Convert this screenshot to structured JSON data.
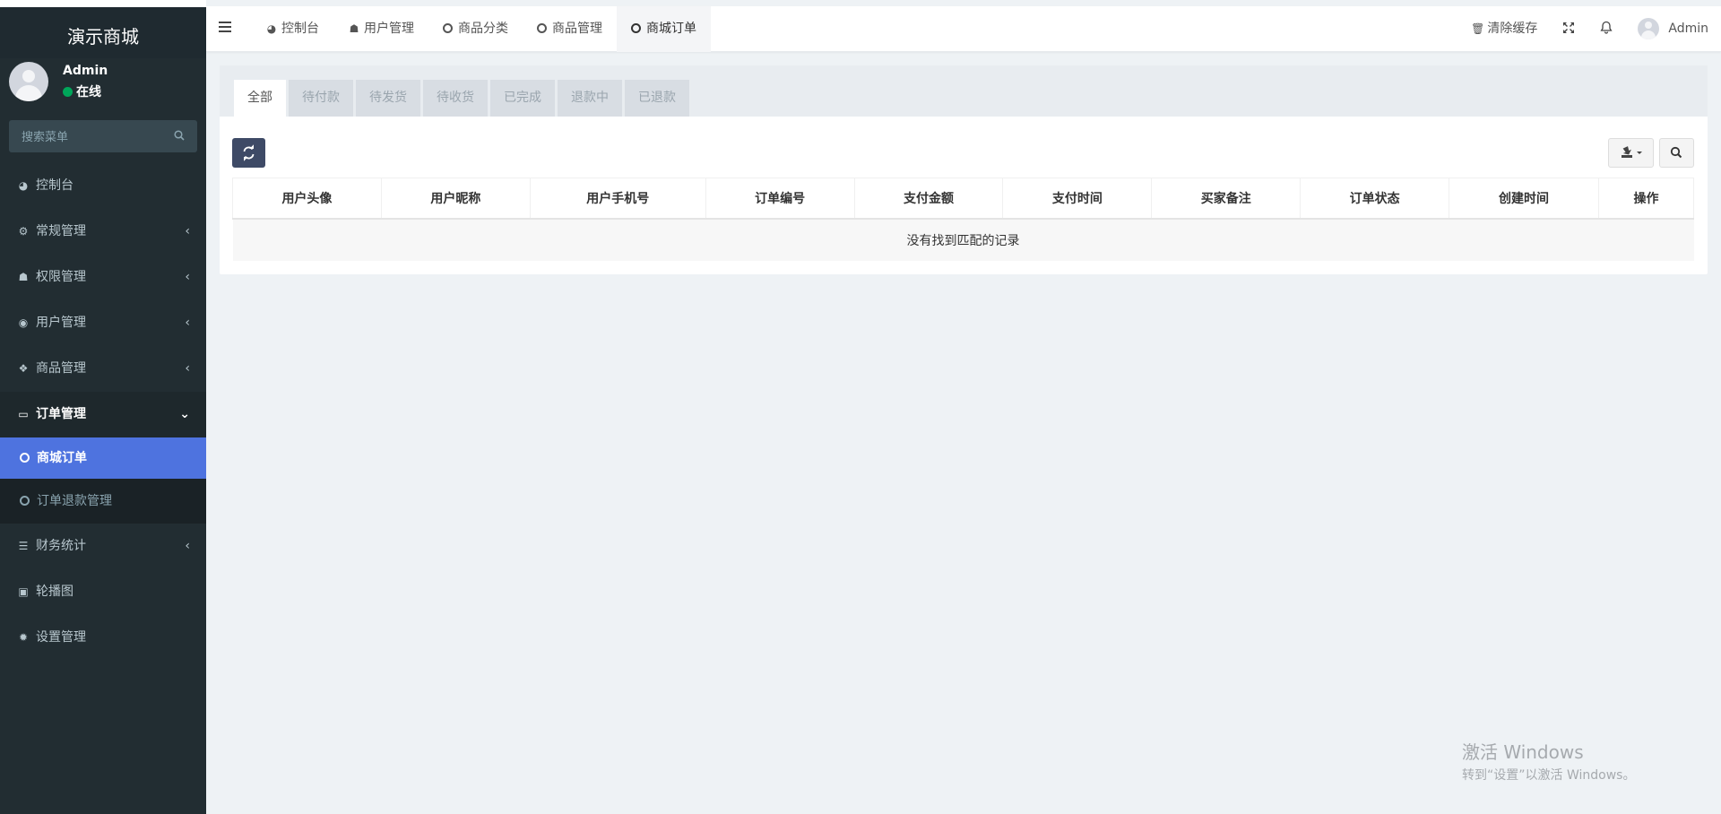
{
  "brand": {
    "title": "演示商城"
  },
  "user": {
    "name": "Admin",
    "status": "在线"
  },
  "sidebar": {
    "search_placeholder": "搜索菜单",
    "items": [
      {
        "label": "控制台",
        "icon": "dashboard-icon",
        "glyph": "◕"
      },
      {
        "label": "常规管理",
        "icon": "cogs-icon",
        "glyph": "⚙",
        "arrow": "‹"
      },
      {
        "label": "权限管理",
        "icon": "users-icon",
        "glyph": "☗",
        "arrow": "‹"
      },
      {
        "label": "用户管理",
        "icon": "user-circle-icon",
        "glyph": "◉",
        "arrow": "‹"
      },
      {
        "label": "商品管理",
        "icon": "cubes-icon",
        "glyph": "❖",
        "arrow": "‹"
      },
      {
        "label": "订单管理",
        "icon": "desktop-icon",
        "glyph": "▭",
        "arrow": "⌄"
      },
      {
        "label": "财务统计",
        "icon": "list-icon",
        "glyph": "☰",
        "arrow": "‹"
      },
      {
        "label": "轮播图",
        "icon": "image-icon",
        "glyph": "▣"
      },
      {
        "label": "设置管理",
        "icon": "gear-icon",
        "glyph": "✹"
      }
    ],
    "submenu": [
      {
        "label": "商城订单"
      },
      {
        "label": "订单退款管理"
      }
    ]
  },
  "topbar": {
    "tabs": [
      {
        "label": "控制台",
        "icon": "dashboard-icon"
      },
      {
        "label": "用户管理",
        "icon": "user-icon"
      },
      {
        "label": "商品分类",
        "icon": "circle-icon"
      },
      {
        "label": "商品管理",
        "icon": "circle-icon"
      },
      {
        "label": "商城订单",
        "icon": "circle-icon"
      }
    ],
    "clear_cache": "清除缓存",
    "admin_name": "Admin"
  },
  "order_tabs": [
    "全部",
    "待付款",
    "待发货",
    "待收货",
    "已完成",
    "退款中",
    "已退款"
  ],
  "table": {
    "columns": [
      "用户头像",
      "用户昵称",
      "用户手机号",
      "订单编号",
      "支付金额",
      "支付时间",
      "买家备注",
      "订单状态",
      "创建时间",
      "操作"
    ],
    "empty_text": "没有找到匹配的记录"
  },
  "watermark": {
    "line1": "激活 Windows",
    "line2": "转到“设置”以激活 Windows。"
  }
}
